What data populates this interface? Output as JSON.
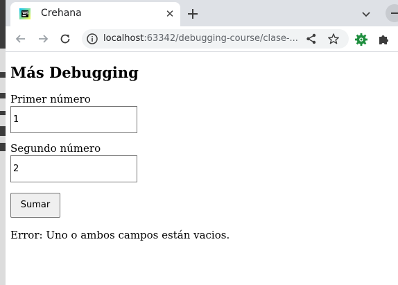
{
  "browser": {
    "tab": {
      "title": "Crehana"
    },
    "url": {
      "host": "localhost",
      "rest": ":63342/debugging-course/clase-..."
    }
  },
  "page": {
    "title": "Más Debugging",
    "first_label": "Primer número",
    "first_value": "1",
    "second_label": "Segundo número",
    "second_value": "2",
    "button_label": "Sumar",
    "error_text": "Error: Uno o ambos campos están vacios."
  },
  "icons": {
    "favicon": "webstorm-favicon",
    "tab_close": "close-icon",
    "new_tab": "plus-icon",
    "tab_search": "chevron-down-icon",
    "minimize": "minimize-icon",
    "back": "arrow-left-icon",
    "forward": "arrow-right-icon",
    "reload": "reload-icon",
    "site_info": "info-icon",
    "share": "share-icon",
    "bookmark": "star-icon",
    "extension": "gear-extension-icon",
    "extensions_menu": "puzzle-icon"
  },
  "colors": {
    "tabbar": "#dee1e6",
    "omnibox": "#f1f3f4",
    "extension_green": "#1e8e3e"
  }
}
